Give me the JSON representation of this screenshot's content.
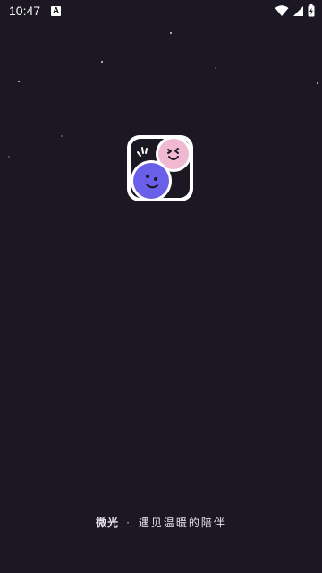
{
  "status_bar": {
    "time": "10:47",
    "notification_icon": "a-badge-icon",
    "wifi_icon": "wifi-icon",
    "signal_icon": "cellular-signal-icon",
    "battery_icon": "battery-charging-icon"
  },
  "splash": {
    "logo_icon": "two-smiling-faces-app-logo",
    "brand_name": "微光",
    "separator": "·",
    "tagline": "遇见温暖的陪伴"
  },
  "colors": {
    "background": "#1b1824",
    "logo_pink": "#f0b9d1",
    "logo_purple": "#6a5fe8",
    "logo_frame": "#ffffff",
    "logo_dark": "#1b1824"
  }
}
